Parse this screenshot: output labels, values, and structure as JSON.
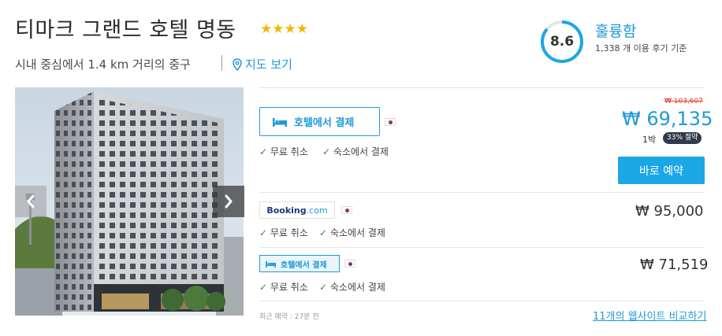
{
  "hotel": {
    "name": "티마크 그랜드 호텔 명동",
    "stars": "★★★★",
    "location": "시내 중심에서 1.4 km 거리의 중구",
    "map_link": "지도 보기"
  },
  "rating": {
    "score": "8.6",
    "score_fraction": 0.86,
    "label": "훌륭함",
    "reviews": "1,338 개 이용 후기 기준"
  },
  "offers": [
    {
      "provider": "호텔에서 결제",
      "amenities": [
        "무료 취소",
        "숙소에서 결제"
      ],
      "old_price": "₩ 103,607",
      "price": "₩ 69,135",
      "per_night": "1박",
      "discount": "33% 절약",
      "book_label": "바로 예약"
    },
    {
      "provider_brand": "Booking",
      "provider_suffix": ".com",
      "amenities": [
        "무료 취소",
        "숙소에서 결제"
      ],
      "price": "₩ 95,000"
    },
    {
      "provider": "호텔에서 결제",
      "amenities": [
        "무료 취소",
        "숙소에서 결제"
      ],
      "price": "₩ 71,519"
    }
  ],
  "footer": {
    "recent": "최근 예약 : 27분 전",
    "compare": "11개의 웹사이트 비교하기"
  },
  "icons": {
    "check": "✓",
    "bed": "bed-icon",
    "pin": "map-pin-icon",
    "chevron_left": "chevron-left-icon",
    "chevron_right": "chevron-right-icon",
    "flag": "korea-flag-icon"
  },
  "colors": {
    "accent": "#1e9ad6",
    "button": "#1ba7e6",
    "stars": "#f2b705",
    "strike": "#e03e2d",
    "check": "#3a8f3a"
  }
}
